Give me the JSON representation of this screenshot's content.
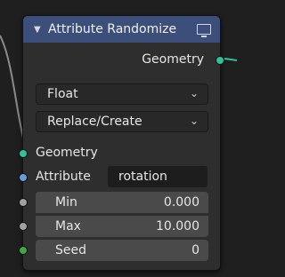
{
  "node": {
    "title": "Attribute Randomize",
    "header_color": "#3b4f7a",
    "output_socket_label": "Geometry",
    "data_type": {
      "selected": "Float"
    },
    "operation": {
      "selected": "Replace/Create"
    },
    "inputs": {
      "geometry_label": "Geometry",
      "attribute_label": "Attribute",
      "attribute_value": "rotation",
      "min": {
        "label": "Min",
        "value": "0.000"
      },
      "max": {
        "label": "Max",
        "value": "10.000"
      },
      "seed": {
        "label": "Seed",
        "value": "0"
      }
    },
    "socket_colors": {
      "geometry": "#2fc39b",
      "attribute": "#6a9ad8",
      "float": "#a1a1a1",
      "integer": "#3fa844"
    }
  }
}
